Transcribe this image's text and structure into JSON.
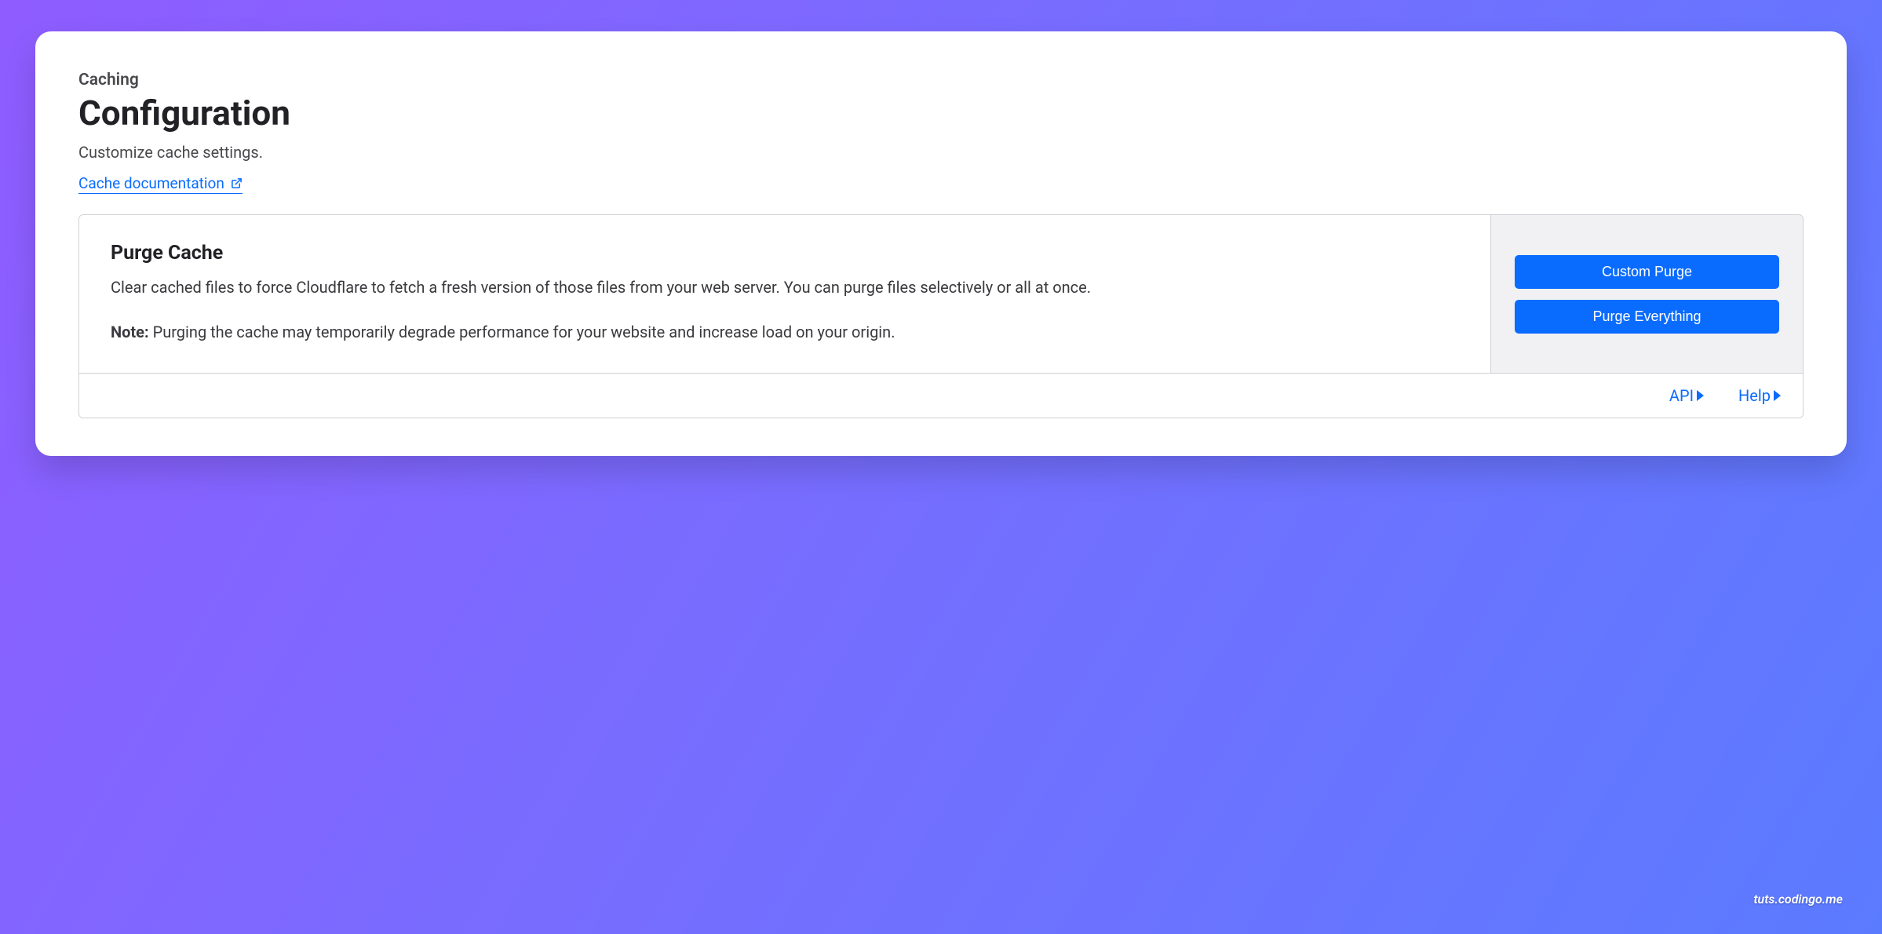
{
  "breadcrumb": "Caching",
  "title": "Configuration",
  "subtitle": "Customize cache settings.",
  "doc_link_text": "Cache documentation",
  "panel": {
    "title": "Purge Cache",
    "description": "Clear cached files to force Cloudflare to fetch a fresh version of those files from your web server. You can purge files selectively or all at once.",
    "note_label": "Note:",
    "note_text": " Purging the cache may temporarily degrade performance for your website and increase load on your origin.",
    "buttons": {
      "custom": "Custom Purge",
      "everything": "Purge Everything"
    },
    "footer": {
      "api": "API",
      "help": "Help"
    }
  },
  "watermark": "tuts.codingo.me"
}
